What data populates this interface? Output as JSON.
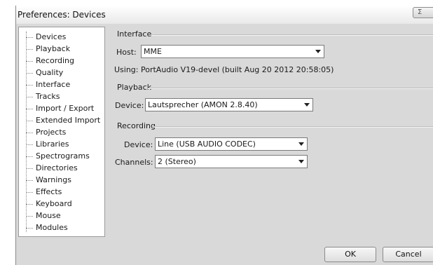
{
  "window": {
    "title": "Preferences: Devices",
    "close_glyph": "Σ"
  },
  "tree": {
    "items": [
      "Devices",
      "Playback",
      "Recording",
      "Quality",
      "Interface",
      "Tracks",
      "Import / Export",
      "Extended Import",
      "Projects",
      "Libraries",
      "Spectrograms",
      "Directories",
      "Warnings",
      "Effects",
      "Keyboard",
      "Mouse",
      "Modules"
    ],
    "selected": "Devices"
  },
  "interface": {
    "title": "Interface",
    "host_label": "Host:",
    "host_value": "MME",
    "using_text": "Using: PortAudio V19-devel (built Aug 20 2012 20:58:05)"
  },
  "playback": {
    "title": "Playback",
    "device_label": "Device:",
    "device_value": "Lautsprecher (AMON 2.8.40)"
  },
  "recording": {
    "title": "Recording",
    "device_label": "Device:",
    "device_value": "Line (USB AUDIO  CODEC)",
    "channels_label": "Channels:",
    "channels_value": "2 (Stereo)"
  },
  "buttons": {
    "ok": "OK",
    "cancel": "Cancel"
  }
}
